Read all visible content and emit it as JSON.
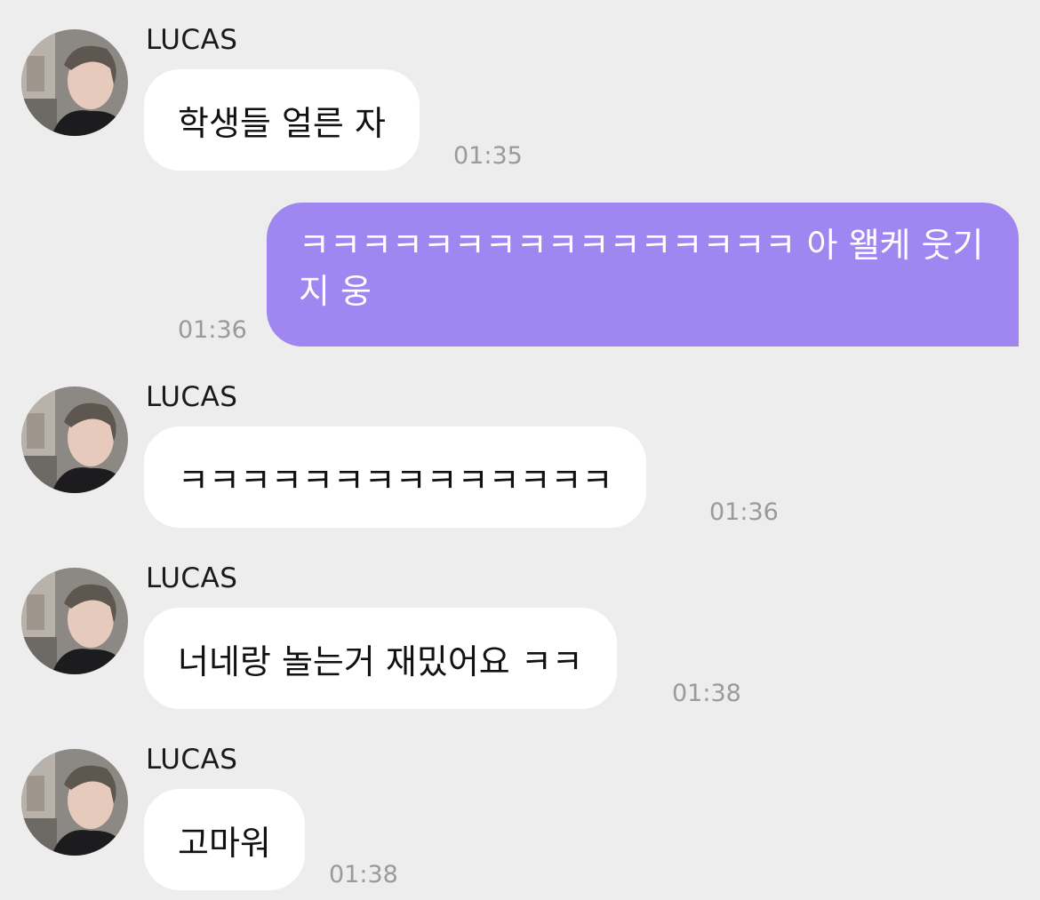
{
  "colors": {
    "background": "#ededed",
    "incoming_bubble": "#ffffff",
    "outgoing_bubble": "#a086f1",
    "timestamp": "#9a9a9a"
  },
  "messages": [
    {
      "direction": "incoming",
      "sender": "LUCAS",
      "text": "학생들 얼른 자",
      "time": "01:35",
      "avatar_icon": "profile-photo-icon"
    },
    {
      "direction": "outgoing",
      "text": "ㅋㅋㅋㅋㅋㅋㅋㅋㅋㅋㅋㅋㅋㅋㅋㅋ 아 왤케 웃기지 웅",
      "time": "01:36"
    },
    {
      "direction": "incoming",
      "sender": "LUCAS",
      "text": "ㅋㅋㅋㅋㅋㅋㅋㅋㅋㅋㅋㅋㅋㅋ",
      "time": "01:36",
      "avatar_icon": "profile-photo-icon"
    },
    {
      "direction": "incoming",
      "sender": "LUCAS",
      "text": "너네랑 놀는거 재밌어요 ㅋㅋ",
      "time": "01:38",
      "avatar_icon": "profile-photo-icon"
    },
    {
      "direction": "incoming",
      "sender": "LUCAS",
      "text": "고마워",
      "time": "01:38",
      "avatar_icon": "profile-photo-icon"
    }
  ]
}
